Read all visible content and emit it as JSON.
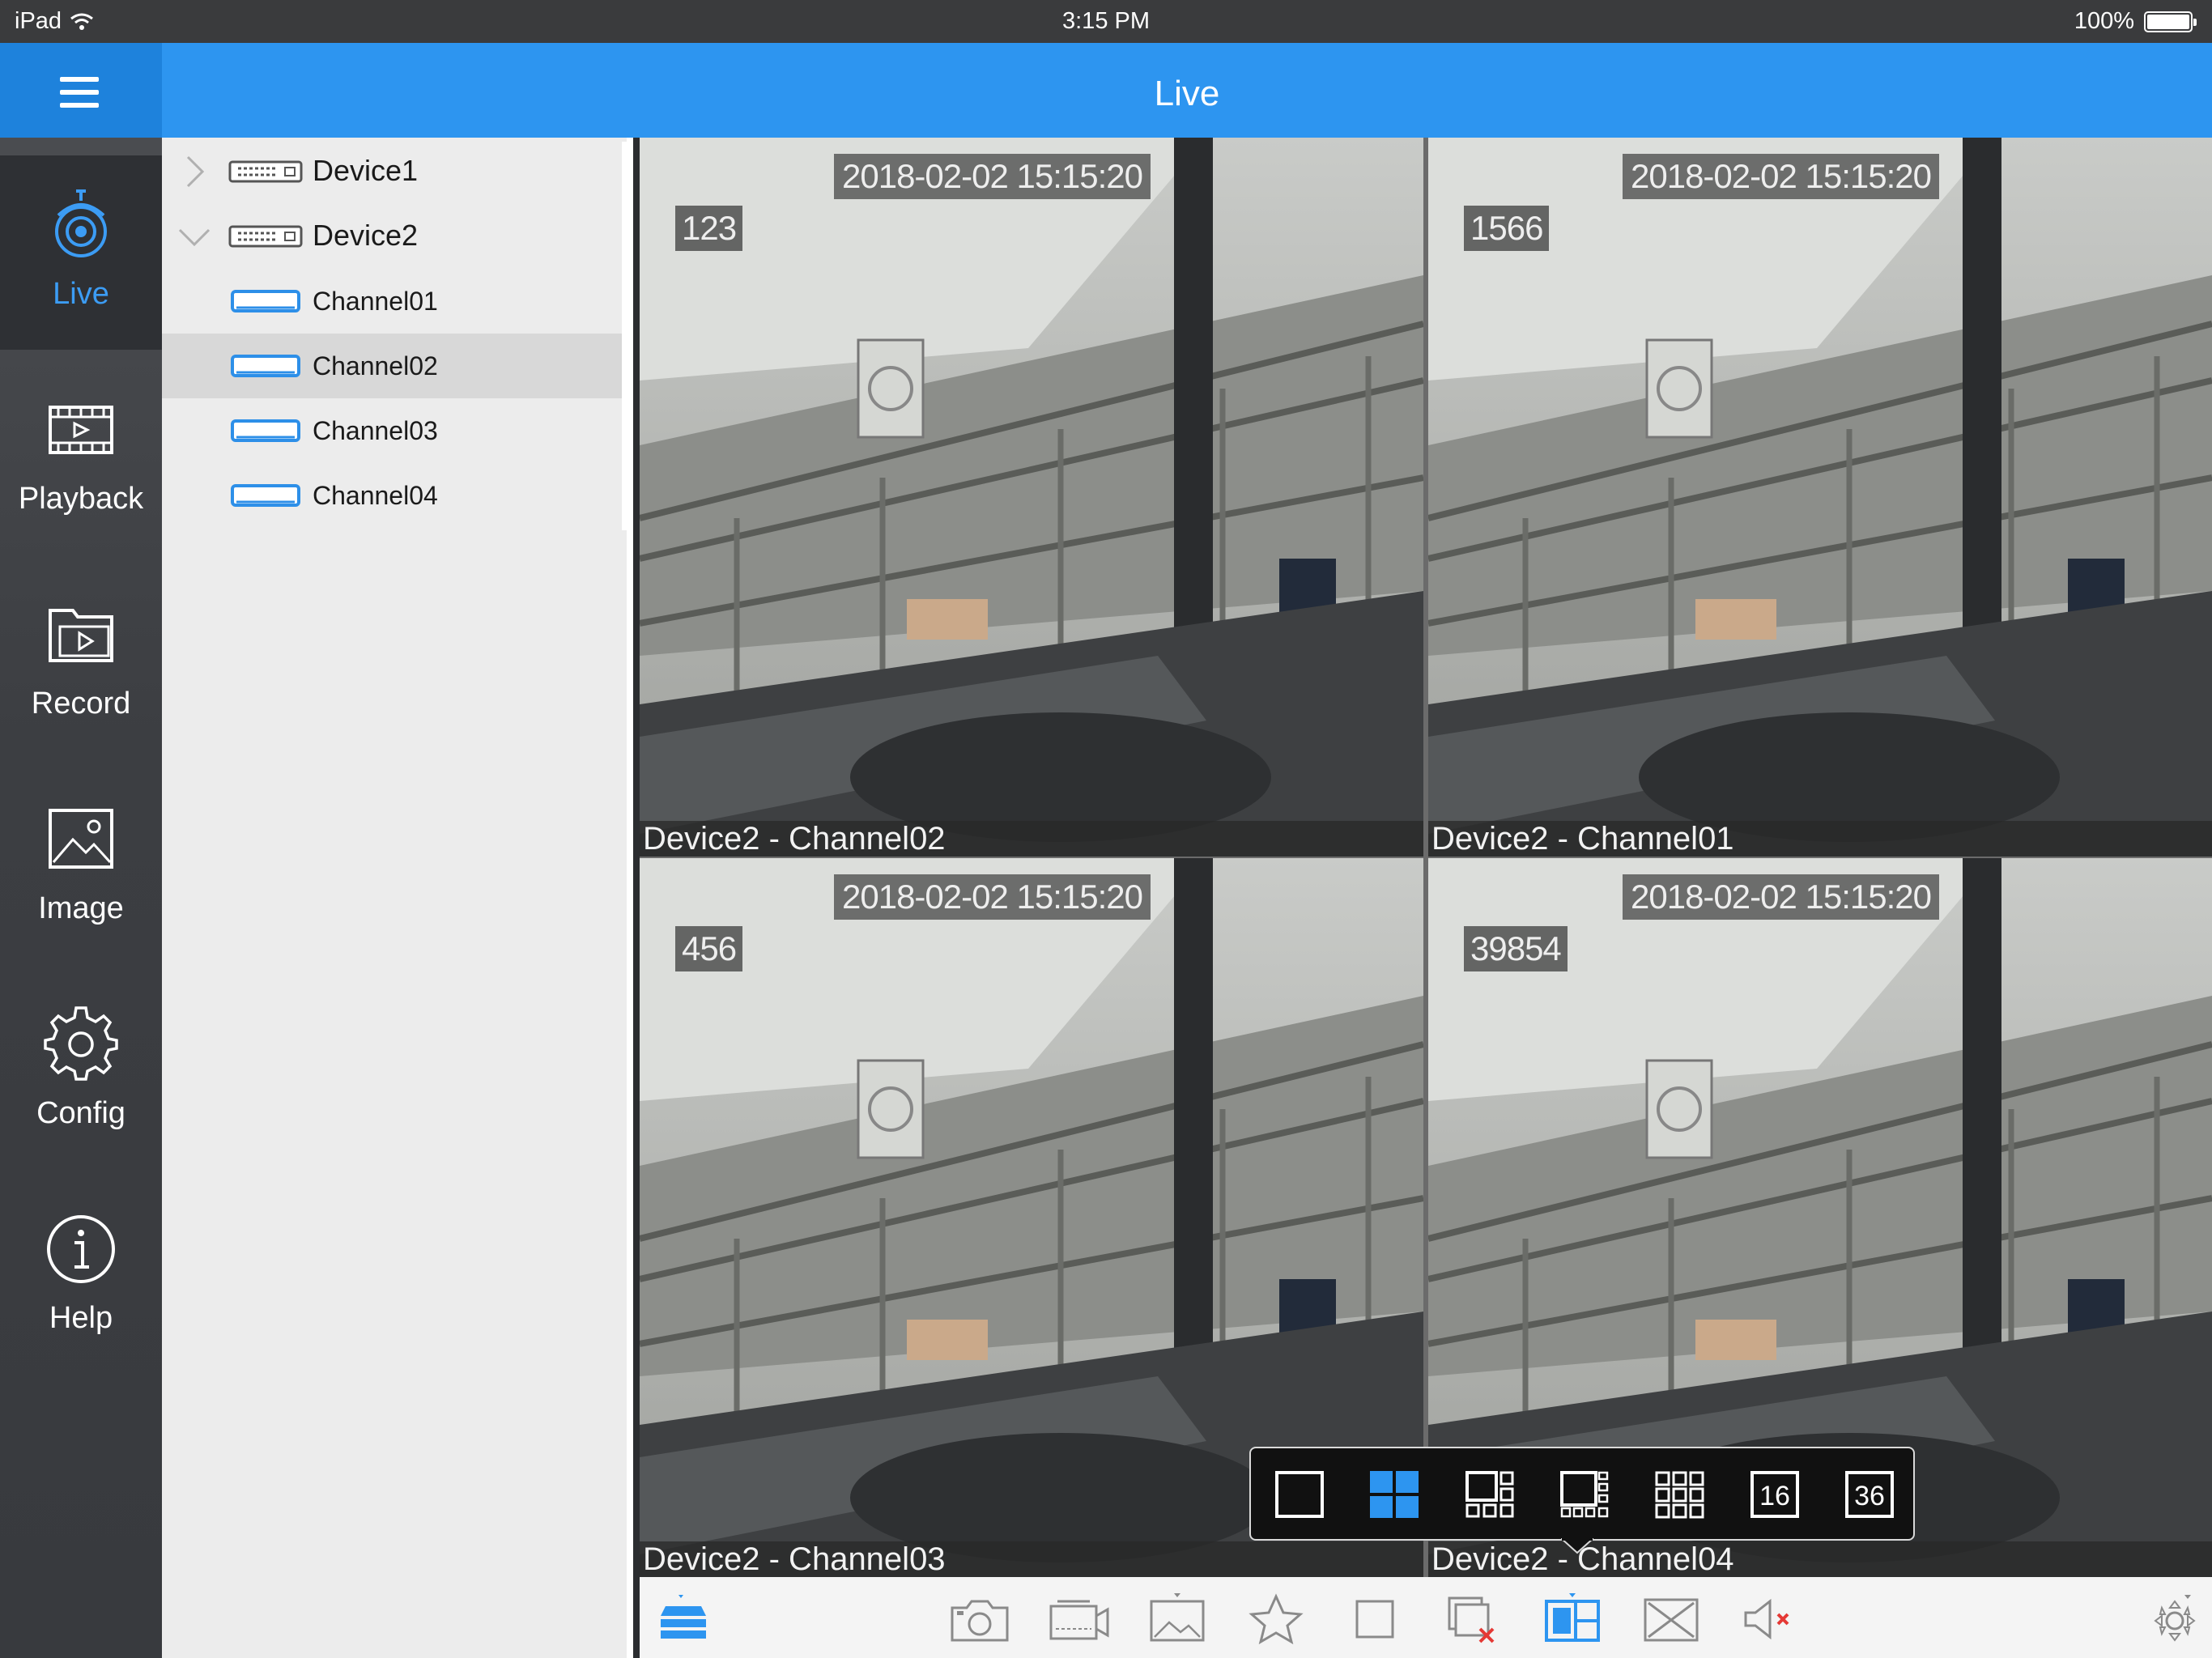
{
  "status_bar": {
    "device": "iPad",
    "time": "3:15 PM",
    "battery": "100%",
    "battery_level": 1.0
  },
  "header": {
    "title": "Live"
  },
  "colors": {
    "accent": "#2d95f0",
    "active_nav_text": "#3c9cf4",
    "selected_tile_border": "#ecec3c",
    "alert": "#e53935"
  },
  "nav": {
    "items": [
      {
        "label": "Live",
        "icon": "camera-icon",
        "active": true
      },
      {
        "label": "Playback",
        "icon": "playback-icon",
        "active": false
      },
      {
        "label": "Record",
        "icon": "record-folder-icon",
        "active": false
      },
      {
        "label": "Image",
        "icon": "image-icon",
        "active": false
      },
      {
        "label": "Config",
        "icon": "gear-icon",
        "active": false
      },
      {
        "label": "Help",
        "icon": "info-icon",
        "active": false
      }
    ]
  },
  "tree": {
    "devices": [
      {
        "name": "Device1",
        "expanded": false
      },
      {
        "name": "Device2",
        "expanded": true
      }
    ],
    "channels": [
      {
        "name": "Channel01",
        "selected": false
      },
      {
        "name": "Channel02",
        "selected": true
      },
      {
        "name": "Channel03",
        "selected": false
      },
      {
        "name": "Channel04",
        "selected": false
      }
    ]
  },
  "tiles": [
    {
      "caption": "Device2 - Channel02",
      "timestamp": "2018-02-02 15:15:20",
      "osd": "123",
      "selected": true
    },
    {
      "caption": "Device2 - Channel01",
      "timestamp": "2018-02-02 15:15:20",
      "osd": "1566",
      "selected": false
    },
    {
      "caption": "Device2 - Channel03",
      "timestamp": "2018-02-02 15:15:20",
      "osd": "456",
      "selected": false
    },
    {
      "caption": "Device2 - Channel04",
      "timestamp": "2018-02-02 15:15:20",
      "osd": "39854",
      "selected": false
    }
  ],
  "split_popup": {
    "options": [
      {
        "name": "split-1-icon",
        "label": "",
        "selected": false
      },
      {
        "name": "split-4-icon",
        "label": "",
        "selected": true
      },
      {
        "name": "split-6-icon",
        "label": "",
        "selected": false
      },
      {
        "name": "split-8-icon",
        "label": "",
        "selected": false
      },
      {
        "name": "split-9-icon",
        "label": "",
        "selected": false
      },
      {
        "name": "split-16-icon",
        "label": "16",
        "selected": false
      },
      {
        "name": "split-36-icon",
        "label": "36",
        "selected": false
      }
    ]
  },
  "toolbar": {
    "icons": [
      "device-list-icon",
      "snapshot-icon",
      "record-video-icon",
      "image-quality-icon",
      "favorite-star-icon",
      "stop-icon",
      "close-all-icon",
      "split-layout-icon",
      "fullscreen-icon",
      "audio-mute-icon",
      "ptz-icon"
    ]
  }
}
